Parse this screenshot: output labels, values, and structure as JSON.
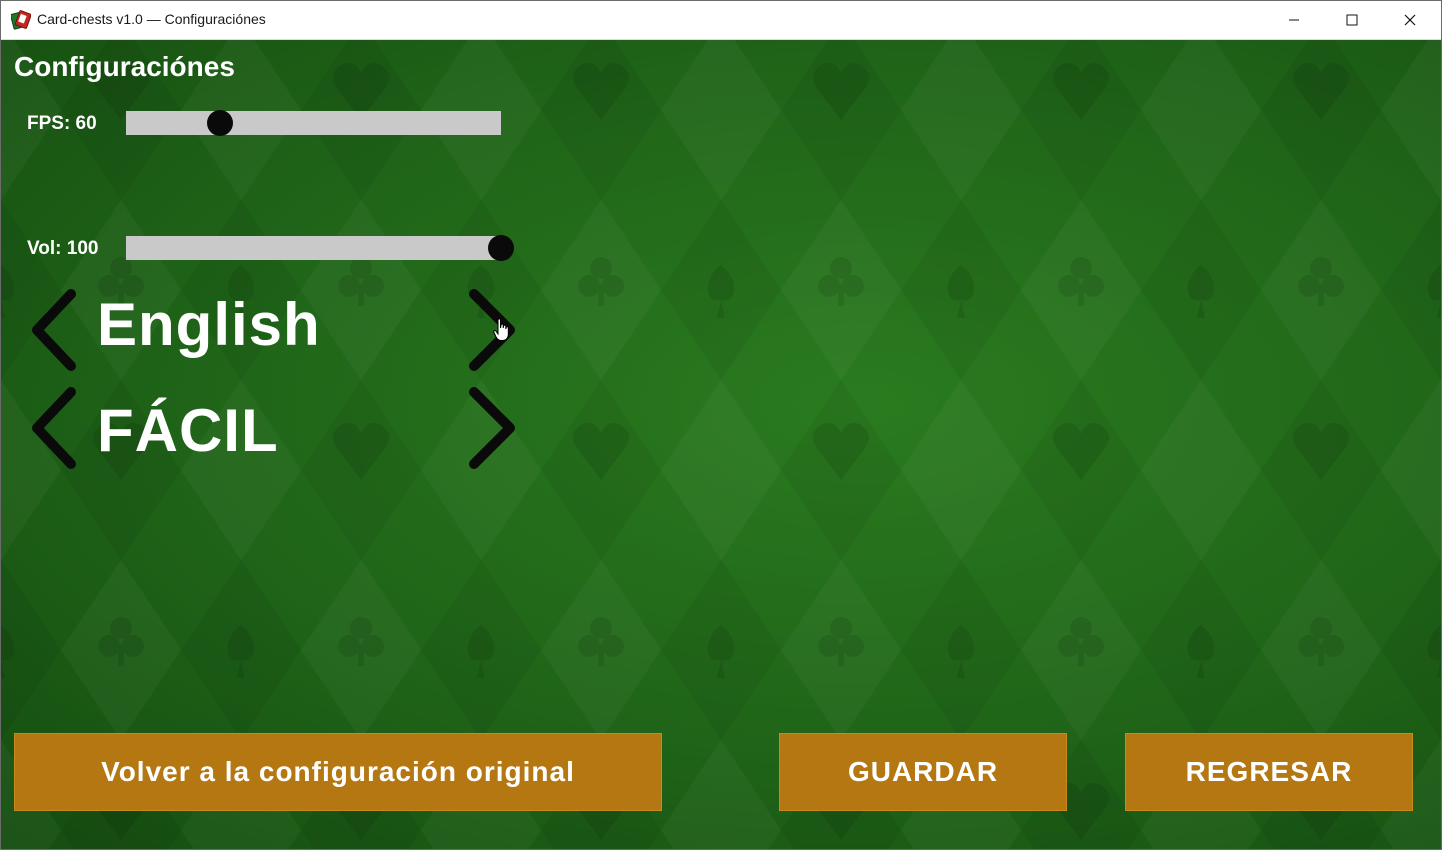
{
  "window": {
    "title": "Card-chests v1.0 — Configuraciónes",
    "controls": [
      "minimize",
      "maximize",
      "close"
    ]
  },
  "settings": {
    "heading": "Configuraciónes",
    "fps": {
      "label": "FPS: 60",
      "value": 60,
      "fraction": 0.25
    },
    "volume": {
      "label": "Vol: 100",
      "value": 100,
      "fraction": 1.0
    },
    "language": {
      "value": "English"
    },
    "difficulty": {
      "value": "FÁCIL"
    }
  },
  "buttons": {
    "reset_label": "Volver a la configuración original",
    "save_label": "GUARDAR",
    "back_label": "REGRESAR"
  },
  "colors": {
    "background": "#1f6418",
    "button": "#b47712",
    "slider_track": "#c9c9c9",
    "slider_thumb": "#0a0a0a"
  },
  "icons": {
    "app": "card-game-icon",
    "prev": "chevron-left-icon",
    "next": "chevron-right-icon"
  }
}
